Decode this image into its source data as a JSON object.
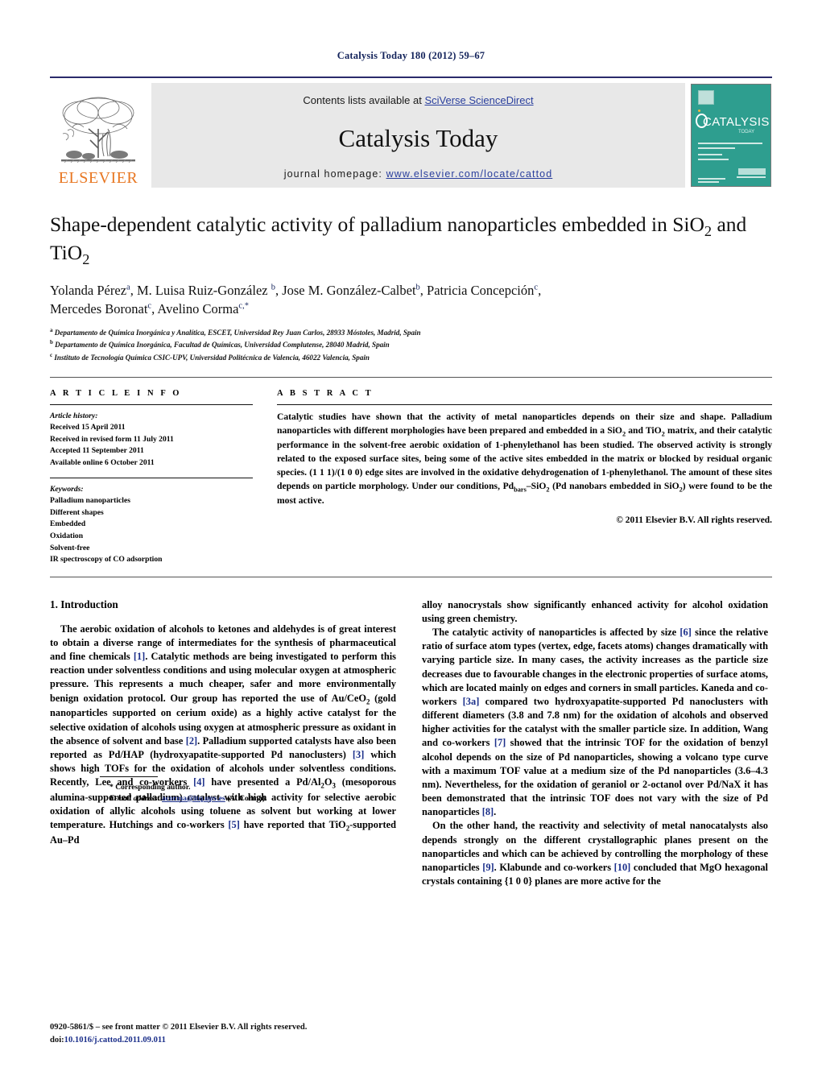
{
  "running_head": "Catalysis Today 180 (2012) 59–67",
  "banner": {
    "contents_prefix": "Contents lists available at ",
    "contents_link": "SciVerse ScienceDirect",
    "journal_name": "Catalysis Today",
    "homepage_prefix": "journal homepage: ",
    "homepage_url": "www.elsevier.com/locate/cattod",
    "publisher_wordmark": "ELSEVIER",
    "publisher_logo_icon": "elsevier-tree-icon",
    "cover_title": "CATALYSIS",
    "cover_subtitle": "TODAY",
    "accent_orange": "#e87722",
    "link_blue": "#2a3f9d",
    "cover_green": "#2e9e8f"
  },
  "article": {
    "title": "Shape-dependent catalytic activity of palladium nanoparticles embedded in SiO2 and TiO2",
    "authors_line1": "Yolanda Pérez a, M. Luisa Ruiz-González b, Jose M. González-Calbet b, Patricia Concepción c,",
    "authors_line2": "Mercedes Boronat c, Avelino Corma c,*",
    "affiliations": [
      "a Departamento de Química Inorgánica y Analítica, ESCET, Universidad Rey Juan Carlos, 28933 Móstoles, Madrid, Spain",
      "b Departamento de Química Inorgánica, Facultad de Químicas, Universidad Complutense, 28040 Madrid, Spain",
      "c Instituto de Tecnología Química CSIC-UPV, Universidad Politécnica de Valencia, 46022 Valencia, Spain"
    ]
  },
  "article_info": {
    "heading": "A R T I C L E   I N F O",
    "history_label": "Article history:",
    "history": [
      "Received 15 April 2011",
      "Received in revised form 11 July 2011",
      "Accepted 11 September 2011",
      "Available online 6 October 2011"
    ],
    "keywords_label": "Keywords:",
    "keywords": [
      "Palladium nanoparticles",
      "Different shapes",
      "Embedded",
      "Oxidation",
      "Solvent-free",
      "IR spectroscopy of CO adsorption"
    ]
  },
  "abstract": {
    "heading": "A B S T R A C T",
    "copyright": "© 2011 Elsevier B.V. All rights reserved."
  },
  "sections": {
    "intro_title": "1. Introduction"
  },
  "footnote": {
    "corresponding": "* Corresponding author.",
    "email_label": "E-mail address:",
    "email": "acorma@itq.upv.es",
    "email_owner": "(A. Corma)."
  },
  "page_footer": {
    "issn_line": "0920-5861/$ – see front matter © 2011 Elsevier B.V. All rights reserved.",
    "doi_label": "doi:",
    "doi": "10.1016/j.cattod.2011.09.011"
  }
}
